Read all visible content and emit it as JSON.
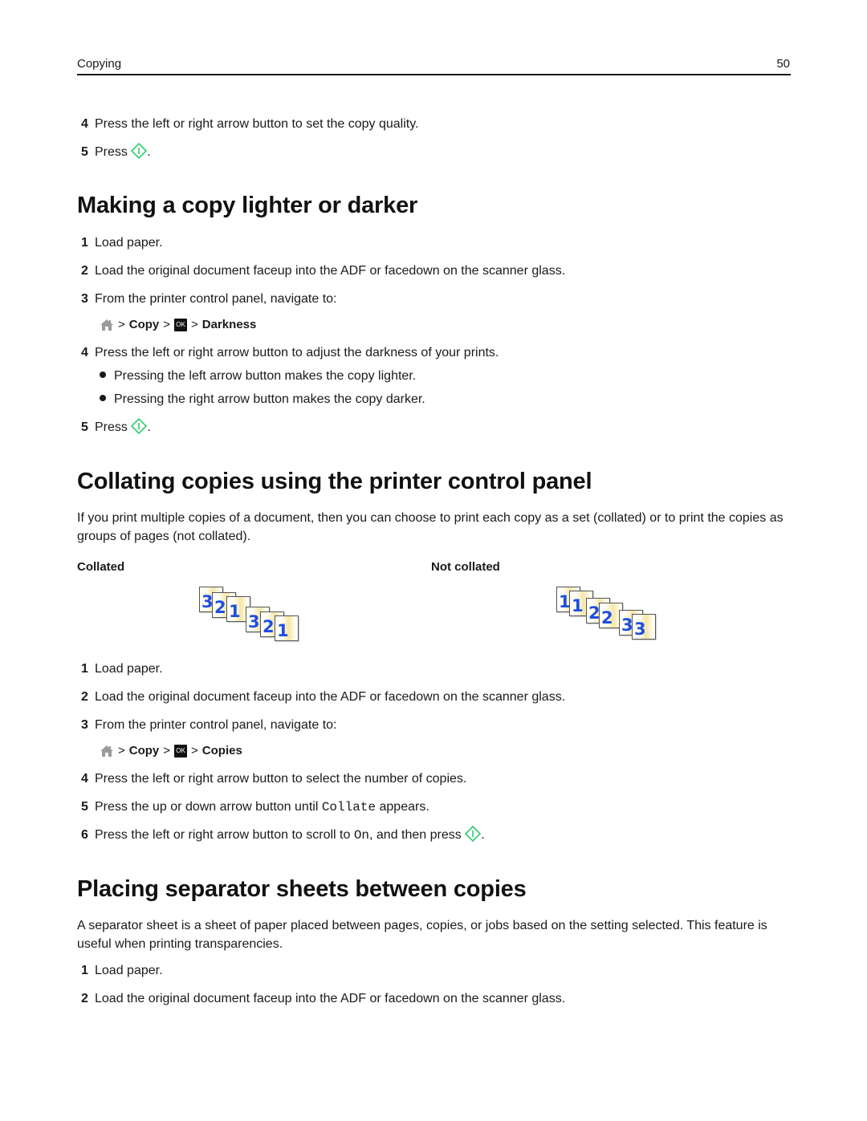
{
  "header": {
    "section": "Copying",
    "page_number": "50"
  },
  "intro_steps": [
    {
      "num": "4",
      "text": "Press the left or right arrow button to set the copy quality."
    },
    {
      "num": "5",
      "text_before": "Press",
      "icon": "start-button-icon",
      "text_after": "."
    }
  ],
  "section_lighter_darker": {
    "title": "Making a copy lighter or darker",
    "steps": [
      {
        "num": "1",
        "text": "Load paper."
      },
      {
        "num": "2",
        "text": "Load the original document faceup into the ADF or facedown on the scanner glass."
      },
      {
        "num": "3",
        "text": "From the printer control panel, navigate to:"
      },
      {
        "num": "4",
        "text": "Press the left or right arrow button to adjust the darkness of your prints."
      },
      {
        "num": "5",
        "text_before": "Press",
        "icon": "start-button-icon",
        "text_after": "."
      }
    ],
    "nav_path": {
      "home_icon": "home-icon",
      "sep": ">",
      "item1": "Copy",
      "ok_label": "OK",
      "item2": "Darkness"
    },
    "bullets": [
      "Pressing the left arrow button makes the copy lighter.",
      "Pressing the right arrow button makes the copy darker."
    ]
  },
  "section_collating": {
    "title": "Collating copies using the printer control panel",
    "intro": "If you print multiple copies of a document, then you can choose to print each copy as a set (collated) or to print the copies as groups of pages (not collated).",
    "collated_label": "Collated",
    "not_collated_label": "Not collated",
    "collated_pages": [
      "3",
      "2",
      "1",
      "3",
      "2",
      "1"
    ],
    "not_collated_pages": [
      "1",
      "1",
      "2",
      "2",
      "3",
      "3"
    ],
    "steps": [
      {
        "num": "1",
        "text": "Load paper."
      },
      {
        "num": "2",
        "text": "Load the original document faceup into the ADF or facedown on the scanner glass."
      },
      {
        "num": "3",
        "text": "From the printer control panel, navigate to:"
      },
      {
        "num": "4",
        "text": "Press the left or right arrow button to select the number of copies."
      },
      {
        "num": "5",
        "text_before": "Press the up or down arrow button until",
        "code": "Collate",
        "text_after": "appears."
      },
      {
        "num": "6",
        "text_before": "Press the left or right arrow button to scroll to",
        "code": "On",
        "text_middle": ", and then press",
        "text_after": "."
      }
    ],
    "nav_path": {
      "home_icon": "home-icon",
      "sep": ">",
      "item1": "Copy",
      "ok_label": "OK",
      "item2": "Copies"
    }
  },
  "section_separator": {
    "title": "Placing separator sheets between copies",
    "intro": "A separator sheet is a sheet of paper placed between pages, copies, or jobs based on the setting selected. This feature is useful when printing transparencies.",
    "steps": [
      {
        "num": "1",
        "text": "Load paper."
      },
      {
        "num": "2",
        "text": "Load the original document faceup into the ADF or facedown on the scanner glass."
      }
    ]
  },
  "colors": {
    "start_icon": "#2ecc71",
    "page_number_blue": "#1f4fe0",
    "home_icon_gray": "#9a9a9a"
  }
}
